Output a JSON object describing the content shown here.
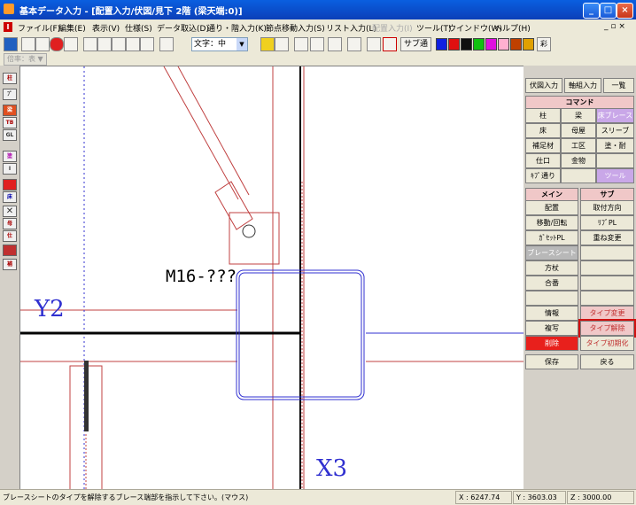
{
  "window": {
    "title": "基本データ入力 - [配置入力/伏図/見下 2階 (梁天端:0)]"
  },
  "menu": {
    "items": [
      "ファイル(F)",
      "編集(E)",
      "表示(V)",
      "仕様(S)",
      "データ取込(D)",
      "通り・階入力(K)",
      "節点移動入力(S)",
      "リスト入力(L)",
      "配置入力(I)",
      "ツール(T)",
      "ウインドウ(W)",
      "ヘルプ(H)"
    ]
  },
  "toolbar": {
    "font_label": "文字：中",
    "toggle_label": "サブ通",
    "zoom_label": "倍率：表"
  },
  "canvas": {
    "label_y2": "Y2",
    "label_x3": "X3",
    "label_member": "M16-???"
  },
  "sidebar": {
    "tabs": [
      "伏図入力",
      "軸組入力",
      "一覧"
    ],
    "command_header": "コマンド",
    "commands": [
      "柱",
      "梁",
      "床ブレース",
      "床",
      "母屋",
      "スリーブ",
      "補足材",
      "工区",
      "塗・耐",
      "仕口",
      "金物",
      "",
      "ｷﾌﾟ通り",
      "",
      "ツール"
    ],
    "main_header": "メイン",
    "sub_header": "サブ",
    "main_items": [
      "配置",
      "移動/回転",
      "ｶﾞｾｯﾄPL",
      "ブレースシート",
      "方杖",
      "合番",
      "",
      "情報",
      "複写",
      "削除"
    ],
    "sub_items": [
      "取付方向",
      "ﾘﾌﾞPL",
      "重ね変更",
      "",
      "",
      "",
      "",
      "タイプ変更",
      "タイプ解除",
      "タイプ初期化"
    ],
    "save_label": "保存",
    "back_label": "戻る"
  },
  "status": {
    "message": "ブレースシートのタイプを解除するブレース端部を指示して下さい。(マウス)",
    "x_coord": "X : 6247.74",
    "y_coord": "Y : 3603.03",
    "z_coord": "Z : 3000.00"
  },
  "colors": {
    "title_blue": "#0b3fb8",
    "grid_red": "#c04040",
    "brace_blue": "#3030d0",
    "delete_red": "#e8201c",
    "highlight_red": "#d01010"
  }
}
